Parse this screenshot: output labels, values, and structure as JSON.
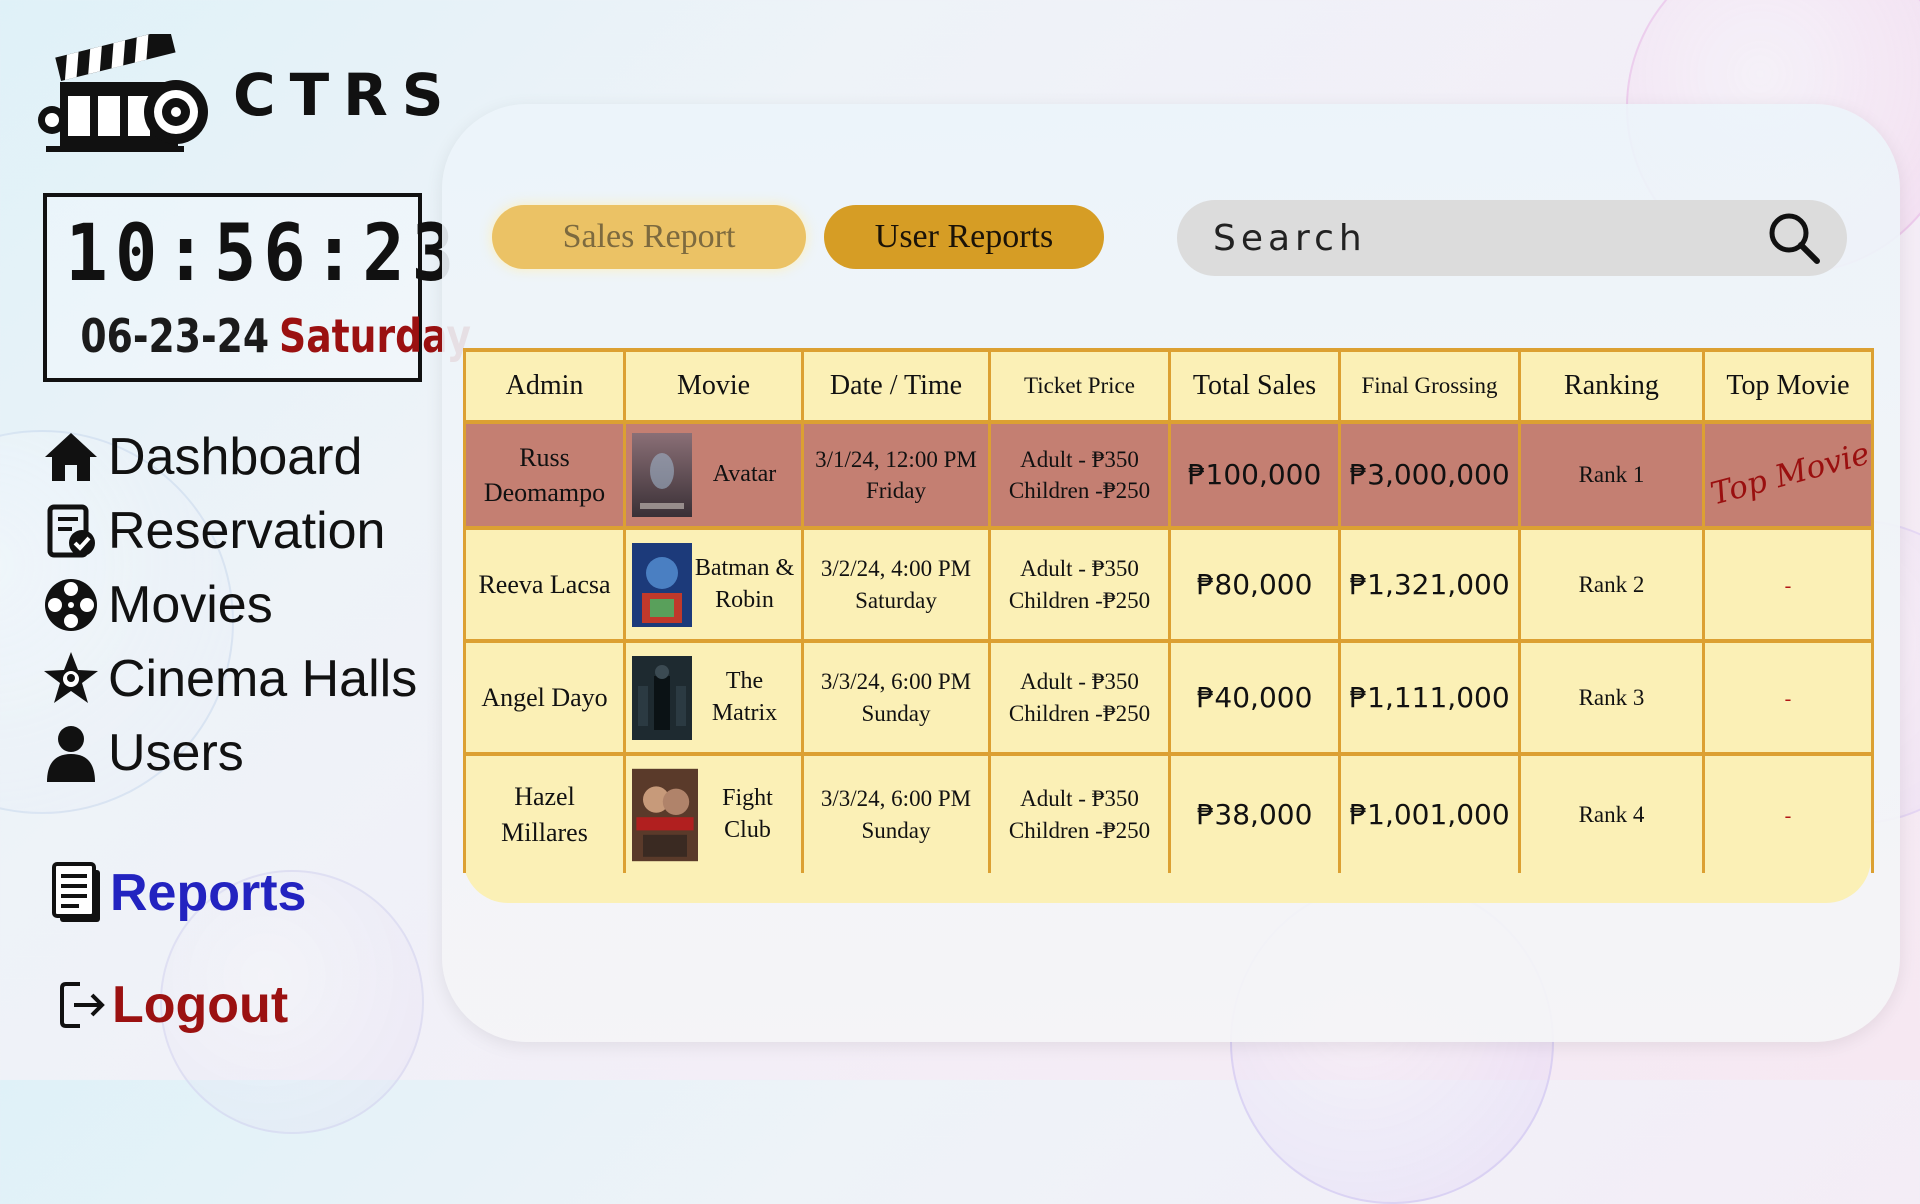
{
  "brand": {
    "name": "CTRS"
  },
  "clock": {
    "time": "10:56:23",
    "date": "06-23-24",
    "weekday": "Saturday"
  },
  "nav": [
    {
      "label": "Dashboard",
      "icon": "home-icon"
    },
    {
      "label": "Reservation",
      "icon": "reservation-icon"
    },
    {
      "label": "Movies",
      "icon": "film-reel-icon"
    },
    {
      "label": "Cinema Halls",
      "icon": "cinema-hall-icon"
    },
    {
      "label": "Users",
      "icon": "user-icon"
    }
  ],
  "reports_label": "Reports",
  "logout_label": "Logout",
  "tabs": {
    "sales": "Sales Report",
    "users": "User Reports"
  },
  "search": {
    "placeholder": "Search"
  },
  "table": {
    "headers": [
      "Admin",
      "Movie",
      "Date / Time",
      "Ticket Price",
      "Total Sales",
      "Final Grossing",
      "Ranking",
      "Top Movie"
    ],
    "rows": [
      {
        "admin": "Russ Deomampo",
        "movie": "Avatar",
        "datetime": "3/1/24, 12:00 PM",
        "day": "Friday",
        "adult_price": "Adult - ₱350",
        "child_price": "Children -₱250",
        "total_sales": "₱100,000",
        "final_grossing": "₱3,000,000",
        "rank": "Rank 1",
        "top_movie": "Top Movie"
      },
      {
        "admin": "Reeva Lacsa",
        "movie": "Batman & Robin",
        "datetime": "3/2/24, 4:00 PM",
        "day": "Saturday",
        "adult_price": "Adult - ₱350",
        "child_price": "Children -₱250",
        "total_sales": "₱80,000",
        "final_grossing": "₱1,321,000",
        "rank": "Rank 2",
        "top_movie": "-"
      },
      {
        "admin": "Angel Dayo",
        "movie": "The Matrix",
        "datetime": "3/3/24, 6:00 PM",
        "day": "Sunday",
        "adult_price": "Adult - ₱350",
        "child_price": "Children -₱250",
        "total_sales": "₱40,000",
        "final_grossing": "₱1,111,000",
        "rank": "Rank 3",
        "top_movie": "-"
      },
      {
        "admin": "Hazel Millares",
        "movie": "Fight Club",
        "datetime": "3/3/24, 6:00 PM",
        "day": "Sunday",
        "adult_price": "Adult - ₱350",
        "child_price": "Children -₱250",
        "total_sales": "₱38,000",
        "final_grossing": "₱1,001,000",
        "rank": "Rank 4",
        "top_movie": "-"
      }
    ]
  },
  "colors": {
    "accent_gold": "#d69d25",
    "tab_light": "#ebc265",
    "highlight_row": "#c47f72",
    "table_bg": "#fbf0b6",
    "reports_blue": "#2323c0",
    "logout_red": "#9b1111"
  }
}
